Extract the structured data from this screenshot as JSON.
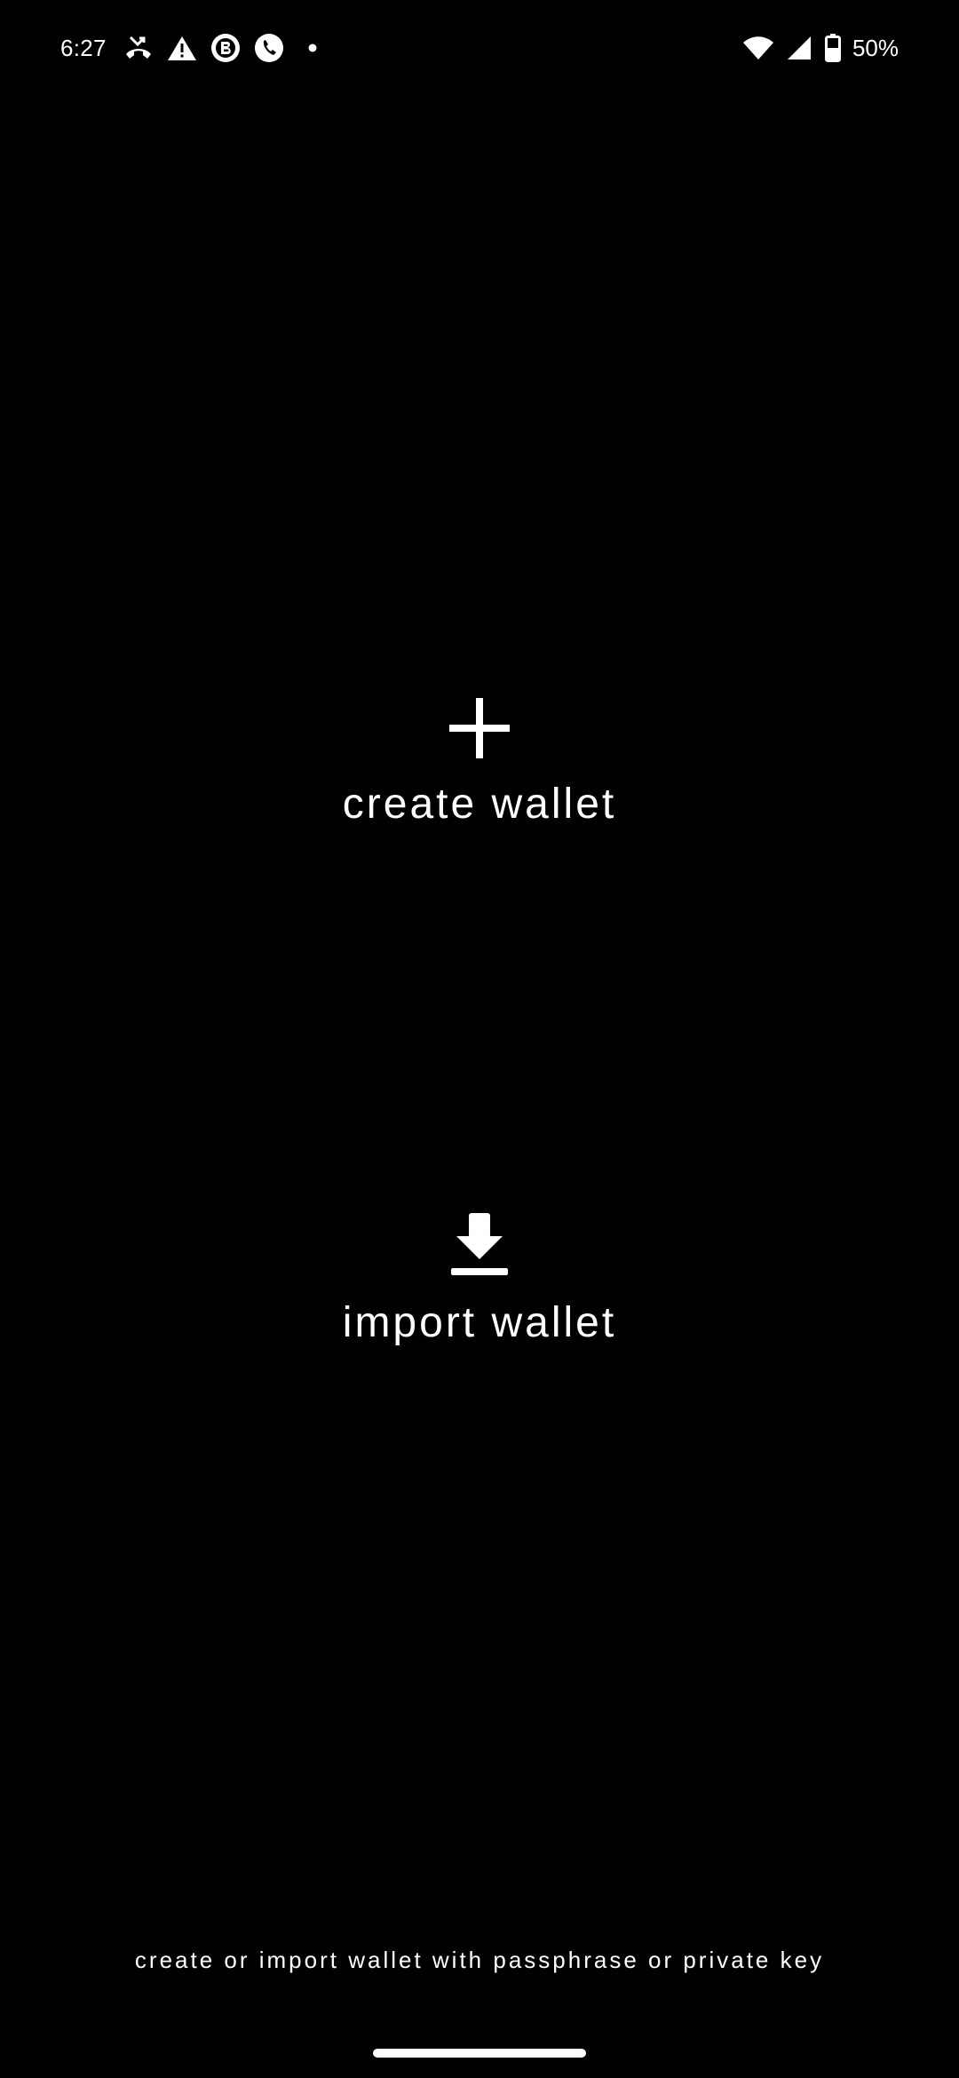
{
  "status_bar": {
    "time": "6:27",
    "left_icons": [
      "missed-call-icon",
      "warning-icon",
      "b-app-icon",
      "phone-icon",
      "dot-icon"
    ],
    "right_icons": [
      "wifi-icon",
      "cell-signal-icon",
      "battery-icon"
    ],
    "battery": "50%"
  },
  "actions": {
    "create": {
      "label": "create wallet",
      "icon": "plus-icon"
    },
    "import": {
      "label": "import wallet",
      "icon": "download-icon"
    }
  },
  "hint": "create or import wallet with passphrase or private key",
  "colors": {
    "background": "#000000",
    "foreground": "#ffffff"
  }
}
